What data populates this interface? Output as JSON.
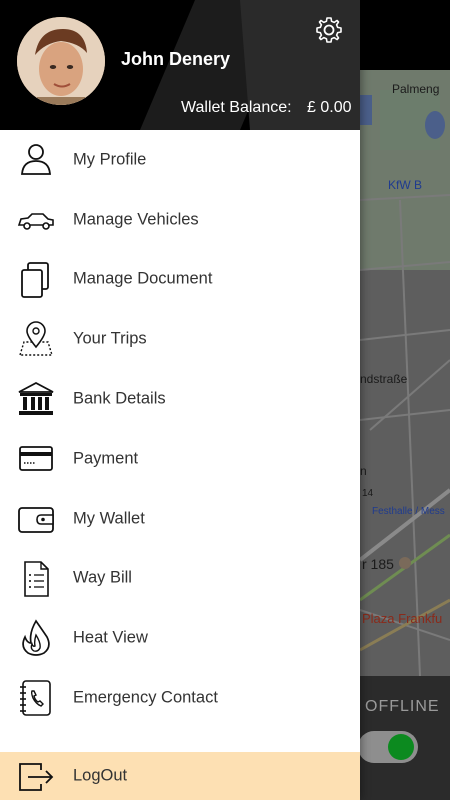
{
  "user": {
    "name": "John Denery",
    "wallet_label": "Wallet Balance:",
    "wallet_value": "£ 0.00"
  },
  "menu": [
    {
      "label": "My Profile",
      "icon": "user-icon"
    },
    {
      "label": "Manage Vehicles",
      "icon": "car-icon"
    },
    {
      "label": "Manage Document",
      "icon": "documents-icon"
    },
    {
      "label": "Your Trips",
      "icon": "map-pin-icon"
    },
    {
      "label": "Bank Details",
      "icon": "bank-icon"
    },
    {
      "label": "Payment",
      "icon": "credit-card-icon"
    },
    {
      "label": "My Wallet",
      "icon": "wallet-icon"
    },
    {
      "label": "Way Bill",
      "icon": "bill-icon"
    },
    {
      "label": "Heat View",
      "icon": "flame-icon"
    },
    {
      "label": "Emergency Contact",
      "icon": "phone-book-icon"
    }
  ],
  "logout": {
    "label": "LogOut",
    "icon": "logout-icon"
  },
  "map": {
    "labels": [
      "Palmeng",
      "KfW B",
      "ndstraße",
      "n",
      "14",
      "Festhalle / Mess",
      "r 185",
      "Plaza Frankfu"
    ]
  },
  "status": {
    "offline_label": "OFFLINE"
  },
  "colors": {
    "header_bg": "#000000",
    "logout_bg": "#fde0b3",
    "toggle_on": "#0c8a1f"
  }
}
